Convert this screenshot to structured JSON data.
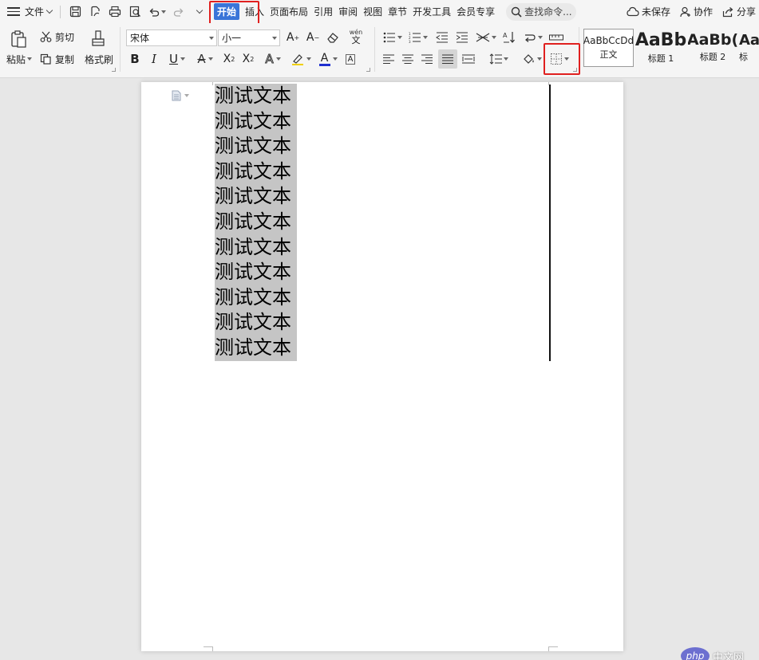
{
  "menubar": {
    "file_label": "文件",
    "tabs": [
      "开始",
      "插入",
      "页面布局",
      "引用",
      "审阅",
      "视图",
      "章节",
      "开发工具",
      "会员专享"
    ],
    "search_label": "查找命令...",
    "unsaved_label": "未保存",
    "collab_label": "协作",
    "share_label": "分享"
  },
  "ribbon": {
    "paste_label": "粘贴",
    "cut_label": "剪切",
    "copy_label": "复制",
    "format_painter_label": "格式刷",
    "font_name": "宋体",
    "font_size": "小一",
    "phonetic_label": "wén",
    "styles": [
      {
        "preview": "AaBbCcDd",
        "name": "正文"
      },
      {
        "preview": "AaBb",
        "name": "标题 1"
      },
      {
        "preview": "AaBb(",
        "name": "标题 2"
      },
      {
        "preview": "Aa",
        "name": "标"
      }
    ]
  },
  "document": {
    "lines": [
      "测试文本",
      "测试文本",
      "测试文本",
      "测试文本",
      "测试文本",
      "测试文本",
      "测试文本",
      "测试文本",
      "测试文本",
      "测试文本",
      "测试文本"
    ]
  },
  "watermark": {
    "badge": "php",
    "text": "中文网"
  },
  "colors": {
    "accent": "#3a75d8",
    "highlight_box": "#e0201f",
    "selection": "#c5c5c5"
  }
}
